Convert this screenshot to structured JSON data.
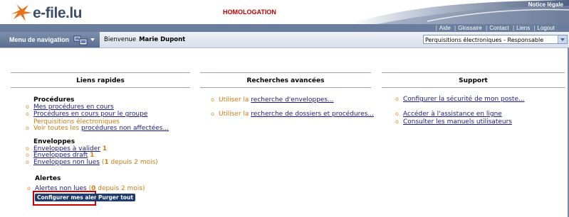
{
  "header": {
    "logo_text": "e-file.lu",
    "environment": "HOMOLOGATION",
    "notice_link": "Notice légale"
  },
  "topmenu": {
    "items": [
      "Aide",
      "Glossaire",
      "Contact",
      "Liens",
      "Logout"
    ]
  },
  "navbar": {
    "menu_label": "Menu de navigation",
    "welcome_label": "Bienvenue",
    "user_name": "Marie Dupont",
    "role_selected": "Perquisitions électroniques - Responsable"
  },
  "quick_links": {
    "title": "Liens rapides",
    "procedures": {
      "title": "Procédures",
      "mine": "Mes procédures en cours",
      "group": "Procédures en cours pour le groupe",
      "group_suffix": "Perquisitions électroniques",
      "all_prefix": "Voir toutes les",
      "all_link": "procédures non affectées..."
    },
    "envelopes": {
      "title": "Enveloppes",
      "to_validate": "Enveloppes à valider",
      "to_validate_count": "1",
      "draft": "Enveloppes draft",
      "draft_count": "1",
      "unread": "Enveloppes non lues",
      "unread_prefix": "(",
      "unread_count": "1",
      "unread_suffix": "depuis 2 mois)"
    },
    "alerts": {
      "title": "Alertes",
      "unread": "Alertes non lues",
      "unread_prefix": "(",
      "unread_count": "0",
      "unread_suffix": "depuis 2 mois)",
      "configure_button": "Configurer mes alertes",
      "purge_button": "Purger tout"
    }
  },
  "advanced_search": {
    "title": "Recherches avancées",
    "use_prefix": "Utiliser la",
    "envelopes_link": "recherche d'enveloppes...",
    "files_link": "recherche de dossiers et procédures..."
  },
  "support": {
    "title": "Support",
    "security_link": "Configurer la sécurité de mon poste...",
    "assistance_link": "Accéder à l'assistance en ligne",
    "manuals_link": "Consulter les manuels utilisateurs"
  }
}
